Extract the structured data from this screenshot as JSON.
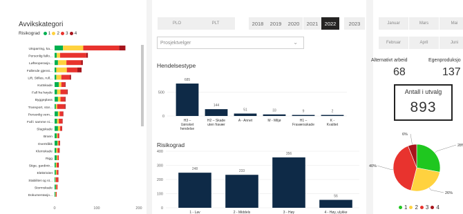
{
  "left": {
    "title": "Avvikskategori",
    "legend_label": "Risikograd",
    "legend_items": [
      {
        "label": "1",
        "color": "#00b050"
      },
      {
        "label": "2",
        "color": "#ffd23f"
      },
      {
        "label": "3",
        "color": "#e8332e"
      },
      {
        "label": "4",
        "color": "#a6141b"
      }
    ],
    "axis_ticks": [
      "0",
      "100",
      "200"
    ]
  },
  "mid": {
    "buttons": [
      "PLO",
      "PLT"
    ],
    "years": [
      "2018",
      "2019",
      "2020",
      "2021",
      "2022",
      "2023"
    ],
    "active_year": "2022",
    "project_select": "Prosjektvelger",
    "hendelsestype_title": "Hendelsestype",
    "risikograd_title": "Risikograd"
  },
  "right": {
    "months_row1": [
      "Januar",
      "Mars",
      "Mai"
    ],
    "months_row2": [
      "Februar",
      "April",
      "Juni"
    ],
    "kpi1_label": "Alternativt arbeid",
    "kpi1_value": "68",
    "kpi2_label": "Egenproduksjo",
    "kpi2_value": "137",
    "card_label": "Antall i utvalg",
    "card_value": "893",
    "pie_labels": [
      "28%",
      "26%",
      "40%",
      "6%"
    ],
    "pie_legend": [
      "1",
      "2",
      "3",
      "4"
    ]
  },
  "chart_data": [
    {
      "type": "bar",
      "orientation": "horizontal",
      "stacked": true,
      "categories": [
        "Utsparring, ka...",
        "Personlig fallo...",
        "Løfteoperasjo...",
        "Fallende gjenst...",
        "Lift, Stillas, rull...",
        "Kuttskade",
        "Fall fra høyde",
        "Byggeplass",
        "Transport, stor...",
        "Personlig vern...",
        "Fall i samme ni...",
        "Slagskade",
        "Brann",
        "Overtråkk",
        "Klemskade",
        "Rigg",
        "Stige, gardintr...",
        "Elektrisitet",
        "Stabilitet og st...",
        "Stormskade",
        "Dokumentasjo..."
      ],
      "series": [
        {
          "name": "1",
          "values": [
            20,
            5,
            8,
            4,
            4,
            10,
            6,
            8,
            3,
            8,
            6,
            8,
            5,
            7,
            4,
            5,
            3,
            3,
            2,
            3,
            2
          ]
        },
        {
          "name": "2",
          "values": [
            48,
            8,
            20,
            25,
            12,
            6,
            8,
            6,
            3,
            4,
            4,
            5,
            2,
            2,
            3,
            2,
            2,
            2,
            1,
            1,
            1
          ]
        },
        {
          "name": "3",
          "values": [
            85,
            62,
            35,
            25,
            20,
            8,
            15,
            10,
            18,
            8,
            8,
            4,
            3,
            3,
            4,
            3,
            4,
            3,
            5,
            3,
            2
          ]
        },
        {
          "name": "4",
          "values": [
            15,
            4,
            4,
            10,
            3,
            2,
            2,
            2,
            2,
            1,
            1,
            1,
            1,
            1,
            1,
            0,
            1,
            1,
            1,
            0,
            0
          ]
        }
      ],
      "xlim": [
        0,
        200
      ],
      "grid": false
    },
    {
      "type": "bar",
      "title": "Hendelsestype",
      "categories": [
        "H3 – Uønsket hendelse personskker...",
        "H2 – Skade uten fravær",
        "A - Annet",
        "M - Miljø",
        "H1 – Fraværsskade",
        "K - Kvalitet"
      ],
      "values": [
        685,
        144,
        51,
        33,
        9,
        2
      ],
      "ylim": [
        0,
        700
      ],
      "yticks": [
        "0",
        "500"
      ]
    },
    {
      "type": "bar",
      "title": "Risikograd",
      "categories": [
        "1 - Lav",
        "2 - Middels",
        "3 - Høy",
        "4 - Høy, ulykke"
      ],
      "values": [
        248,
        233,
        356,
        56
      ],
      "ylim": [
        0,
        400
      ],
      "yticks": [
        "0",
        "100",
        "200",
        "300",
        "400"
      ]
    },
    {
      "type": "pie",
      "labels": [
        "1",
        "2",
        "3",
        "4"
      ],
      "values": [
        28,
        26,
        40,
        6
      ],
      "colors": [
        "#1fc71f",
        "#ffd23f",
        "#e8332e",
        "#a6141b"
      ]
    }
  ]
}
